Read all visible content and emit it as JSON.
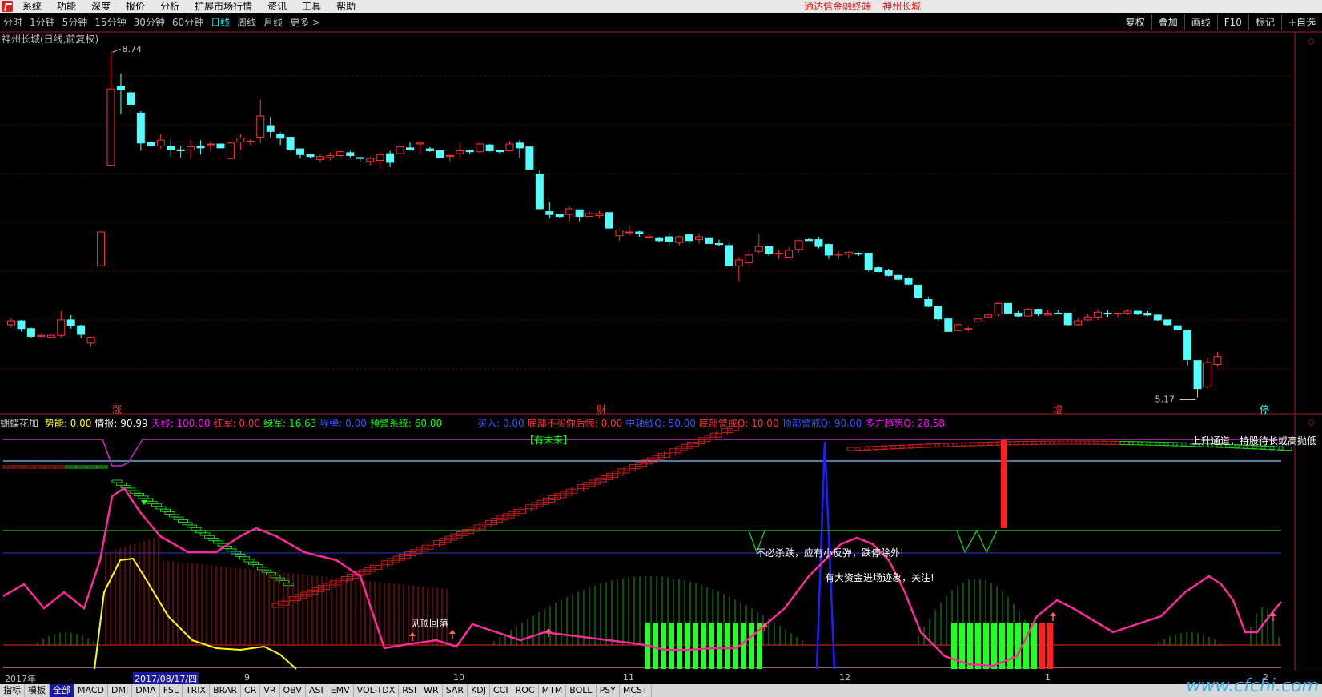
{
  "menu": {
    "items": [
      "系统",
      "功能",
      "深度",
      "报价",
      "分析",
      "扩展市场行情",
      "资讯",
      "工具",
      "帮助"
    ],
    "app_title": "通达信金融终端",
    "stock_title": "神州长城"
  },
  "periods": {
    "items": [
      "分时",
      "1分钟",
      "5分钟",
      "15分钟",
      "30分钟",
      "60分钟",
      "日线",
      "周线",
      "月线",
      "更多 >"
    ],
    "active": "日线",
    "right": [
      "复权",
      "叠加",
      "画线",
      "F10",
      "标记",
      "+自选"
    ]
  },
  "chart": {
    "title": "神州长城(日线,前复权)",
    "high_label": "8.74",
    "low_label": "5.17",
    "marks": [
      "涨",
      "财",
      "增",
      "停"
    ]
  },
  "indicator": {
    "name": "蝴蝶花加",
    "fields": [
      {
        "label": "势能:",
        "value": "0.00",
        "color": "#ffff00"
      },
      {
        "label": "情报:",
        "value": "90.99",
        "color": "#ffffff"
      },
      {
        "label": "天线:",
        "value": "100.00",
        "color": "#ff00ff"
      },
      {
        "label": "红军:",
        "value": "0.00",
        "color": "#ff3333"
      },
      {
        "label": "绿军:",
        "value": "16.63",
        "color": "#00ff00"
      },
      {
        "label": "导弹:",
        "value": "0.00",
        "color": "#3355ff"
      },
      {
        "label": "预警系统:",
        "value": "60.00",
        "color": "#00ff00"
      },
      {
        "label": "买入:",
        "value": "0.00",
        "color": "#3355ff"
      },
      {
        "label": "底部不买你后悔:",
        "value": "0.00",
        "color": "#ff3333"
      },
      {
        "label": "中轴线Q:",
        "value": "50.00",
        "color": "#3355ff"
      },
      {
        "label": "底部警戒Q:",
        "value": "10.00",
        "color": "#ff3333"
      },
      {
        "label": "顶部警戒Q:",
        "value": "90.00",
        "color": "#3355ff"
      },
      {
        "label": "多方趋势Q:",
        "value": "28.58",
        "color": "#ff00ff"
      }
    ],
    "notes": {
      "top_green": "【有未来】",
      "upper_channel": "上升通道，持股待长或高抛低",
      "no_kill": "不必杀跌，应有小反弹，跌停除外!",
      "big_fund": "有大资金进场迹象，关注!",
      "pullback": "见顶回落"
    }
  },
  "datebar": {
    "year": "2017年",
    "selected": "2017/08/17/四",
    "months": [
      "9",
      "10",
      "11",
      "12",
      "1",
      "2"
    ]
  },
  "tabs": {
    "items": [
      "指标",
      "模板",
      "全部",
      "MACD",
      "DMI",
      "DMA",
      "FSL",
      "TRIX",
      "BRAR",
      "CR",
      "VR",
      "OBV",
      "ASI",
      "EMV",
      "VOL-TDX",
      "RSI",
      "WR",
      "SAR",
      "KDJ",
      "CCI",
      "ROC",
      "MTM",
      "BOLL",
      "PSY",
      "MCST"
    ],
    "active": "全部"
  },
  "watermark": "www.cfchi.com",
  "candles": [
    [
      5.92,
      5.99,
      5.89,
      5.96
    ],
    [
      5.96,
      5.97,
      5.85,
      5.88
    ],
    [
      5.88,
      5.89,
      5.78,
      5.8
    ],
    [
      5.8,
      5.83,
      5.79,
      5.81
    ],
    [
      5.79,
      5.82,
      5.78,
      5.81
    ],
    [
      5.81,
      6.06,
      5.79,
      5.97
    ],
    [
      5.97,
      6.02,
      5.88,
      5.91
    ],
    [
      5.91,
      5.92,
      5.78,
      5.82
    ],
    [
      5.73,
      5.79,
      5.69,
      5.79
    ],
    [
      6.53,
      6.88,
      6.53,
      6.88
    ],
    [
      7.57,
      8.74,
      7.57,
      8.36
    ],
    [
      8.39,
      8.52,
      8.1,
      8.35
    ],
    [
      8.32,
      8.36,
      8.09,
      8.2
    ],
    [
      8.11,
      8.13,
      7.72,
      7.8
    ],
    [
      7.81,
      7.82,
      7.76,
      7.77
    ],
    [
      7.77,
      7.89,
      7.74,
      7.83
    ],
    [
      7.77,
      7.84,
      7.66,
      7.73
    ],
    [
      7.73,
      7.77,
      7.65,
      7.72
    ],
    [
      7.73,
      7.83,
      7.64,
      7.76
    ],
    [
      7.77,
      7.83,
      7.68,
      7.75
    ],
    [
      7.79,
      7.82,
      7.71,
      7.79
    ],
    [
      7.79,
      7.77,
      7.77,
      7.75
    ],
    [
      7.64,
      7.81,
      7.63,
      7.8
    ],
    [
      7.81,
      7.89,
      7.73,
      7.85
    ],
    [
      7.82,
      7.84,
      7.78,
      7.82
    ],
    [
      7.86,
      8.25,
      7.8,
      8.08
    ],
    [
      7.98,
      8.07,
      7.86,
      7.92
    ],
    [
      7.89,
      7.91,
      7.78,
      7.85
    ],
    [
      7.86,
      7.83,
      7.72,
      7.73
    ],
    [
      7.74,
      7.73,
      7.64,
      7.68
    ],
    [
      7.68,
      7.68,
      7.64,
      7.66
    ],
    [
      7.63,
      7.68,
      7.6,
      7.66
    ],
    [
      7.65,
      7.7,
      7.62,
      7.67
    ],
    [
      7.67,
      7.73,
      7.64,
      7.71
    ],
    [
      7.7,
      7.72,
      7.65,
      7.67
    ],
    [
      7.65,
      7.66,
      7.6,
      7.64
    ],
    [
      7.61,
      7.66,
      7.57,
      7.64
    ],
    [
      7.62,
      7.71,
      7.54,
      7.68
    ],
    [
      7.69,
      7.72,
      7.55,
      7.6
    ],
    [
      7.69,
      7.76,
      7.62,
      7.76
    ],
    [
      7.75,
      7.81,
      7.72,
      7.73
    ],
    [
      7.79,
      7.82,
      7.68,
      7.8
    ],
    [
      7.74,
      7.76,
      7.71,
      7.72
    ],
    [
      7.72,
      7.7,
      7.63,
      7.65
    ],
    [
      7.66,
      7.68,
      7.61,
      7.67
    ],
    [
      7.69,
      7.8,
      7.63,
      7.72
    ],
    [
      7.72,
      7.73,
      7.69,
      7.71
    ],
    [
      7.71,
      7.82,
      7.7,
      7.79
    ],
    [
      7.78,
      7.79,
      7.71,
      7.72
    ],
    [
      7.72,
      7.73,
      7.69,
      7.71
    ],
    [
      7.72,
      7.82,
      7.72,
      7.79
    ],
    [
      7.8,
      7.83,
      7.65,
      7.75
    ],
    [
      7.76,
      7.71,
      7.53,
      7.53
    ],
    [
      7.48,
      7.52,
      7.12,
      7.12
    ],
    [
      7.09,
      7.19,
      7.02,
      7.06
    ],
    [
      7.06,
      7.04,
      7.03,
      7.04
    ],
    [
      7.06,
      7.14,
      6.99,
      7.12
    ],
    [
      7.11,
      7.07,
      6.99,
      7.04
    ],
    [
      7.04,
      7.09,
      7.04,
      7.07
    ],
    [
      7.05,
      7.1,
      7.03,
      7.07
    ],
    [
      7.08,
      7.09,
      6.92,
      6.92
    ],
    [
      6.84,
      6.91,
      6.79,
      6.9
    ],
    [
      6.88,
      6.94,
      6.84,
      6.88
    ],
    [
      6.88,
      6.89,
      6.83,
      6.86
    ],
    [
      6.83,
      6.86,
      6.81,
      6.83
    ],
    [
      6.82,
      6.83,
      6.77,
      6.79
    ],
    [
      6.83,
      6.87,
      6.73,
      6.78
    ],
    [
      6.77,
      6.84,
      6.74,
      6.83
    ],
    [
      6.85,
      6.84,
      6.76,
      6.79
    ],
    [
      6.8,
      6.86,
      6.76,
      6.83
    ],
    [
      6.82,
      6.88,
      6.75,
      6.76
    ],
    [
      6.76,
      6.8,
      6.73,
      6.75
    ],
    [
      6.74,
      6.77,
      6.54,
      6.53
    ],
    [
      6.53,
      6.62,
      6.37,
      6.59
    ],
    [
      6.56,
      6.7,
      6.52,
      6.64
    ],
    [
      6.68,
      6.86,
      6.66,
      6.73
    ],
    [
      6.73,
      6.72,
      6.63,
      6.66
    ],
    [
      6.66,
      6.7,
      6.6,
      6.66
    ],
    [
      6.62,
      6.72,
      6.61,
      6.69
    ],
    [
      6.7,
      6.79,
      6.67,
      6.79
    ],
    [
      6.8,
      6.82,
      6.79,
      6.79
    ],
    [
      6.8,
      6.83,
      6.71,
      6.73
    ],
    [
      6.75,
      6.76,
      6.6,
      6.64
    ],
    [
      6.64,
      6.68,
      6.6,
      6.65
    ],
    [
      6.65,
      6.68,
      6.61,
      6.67
    ],
    [
      6.66,
      6.67,
      6.63,
      6.65
    ],
    [
      6.66,
      6.61,
      6.47,
      6.49
    ],
    [
      6.51,
      6.53,
      6.46,
      6.47
    ],
    [
      6.48,
      6.5,
      6.42,
      6.43
    ],
    [
      6.43,
      6.44,
      6.38,
      6.39
    ],
    [
      6.4,
      6.41,
      6.33,
      6.34
    ],
    [
      6.33,
      6.33,
      6.19,
      6.2
    ],
    [
      6.18,
      6.21,
      6.1,
      6.11
    ],
    [
      6.11,
      6.11,
      5.96,
      5.98
    ],
    [
      5.98,
      5.99,
      5.85,
      5.85
    ],
    [
      5.86,
      5.94,
      5.85,
      5.92
    ],
    [
      5.88,
      5.9,
      5.85,
      5.88
    ],
    [
      5.95,
      6.0,
      5.95,
      5.98
    ],
    [
      6.0,
      6.04,
      5.99,
      6.02
    ],
    [
      6.03,
      6.15,
      6.01,
      6.14
    ],
    [
      6.14,
      6.1,
      6.03,
      6.04
    ],
    [
      6.04,
      6.06,
      6.0,
      6.01
    ],
    [
      6.01,
      6.09,
      6.01,
      6.08
    ],
    [
      6.08,
      6.04,
      6.01,
      6.03
    ],
    [
      6.02,
      6.07,
      6.01,
      6.04
    ],
    [
      6.04,
      6.07,
      6.03,
      6.03
    ],
    [
      6.04,
      6.0,
      5.91,
      5.92
    ],
    [
      5.92,
      5.99,
      5.91,
      5.96
    ],
    [
      5.97,
      6.03,
      5.96,
      6.0
    ],
    [
      6.0,
      6.08,
      5.97,
      6.05
    ],
    [
      6.04,
      6.07,
      6.0,
      6.03
    ],
    [
      6.03,
      6.04,
      6.0,
      6.04
    ],
    [
      6.04,
      6.08,
      6.02,
      6.06
    ],
    [
      6.06,
      6.06,
      6.02,
      6.03
    ],
    [
      6.04,
      6.06,
      6.01,
      6.02
    ],
    [
      6.02,
      6.0,
      5.96,
      5.97
    ],
    [
      5.97,
      5.96,
      5.91,
      5.92
    ],
    [
      5.91,
      5.91,
      5.86,
      5.87
    ],
    [
      5.86,
      5.72,
      5.5,
      5.56
    ],
    [
      5.55,
      5.35,
      5.17,
      5.26
    ],
    [
      5.28,
      5.58,
      5.26,
      5.53
    ],
    [
      5.51,
      5.64,
      5.49,
      5.59
    ]
  ]
}
